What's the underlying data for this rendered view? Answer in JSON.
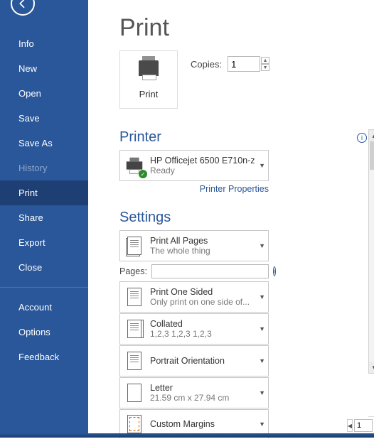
{
  "sidebar": {
    "items": [
      {
        "label": "Info"
      },
      {
        "label": "New"
      },
      {
        "label": "Open"
      },
      {
        "label": "Save"
      },
      {
        "label": "Save As"
      },
      {
        "label": "History"
      },
      {
        "label": "Print"
      },
      {
        "label": "Share"
      },
      {
        "label": "Export"
      },
      {
        "label": "Close"
      }
    ],
    "footer": [
      {
        "label": "Account"
      },
      {
        "label": "Options"
      },
      {
        "label": "Feedback"
      }
    ]
  },
  "page": {
    "title": "Print"
  },
  "print_button": {
    "label": "Print"
  },
  "copies": {
    "label": "Copies:",
    "value": "1"
  },
  "printer": {
    "heading": "Printer",
    "name": "HP Officejet 6500 E710n-z",
    "status": "Ready",
    "properties_link": "Printer Properties"
  },
  "settings": {
    "heading": "Settings",
    "pages_label": "Pages:",
    "pages_value": "",
    "items": {
      "range": {
        "line1": "Print All Pages",
        "line2": "The whole thing"
      },
      "sided": {
        "line1": "Print One Sided",
        "line2": "Only print on one side of..."
      },
      "collate": {
        "line1": "Collated",
        "line2": "1,2,3    1,2,3    1,2,3"
      },
      "orient": {
        "line1": "Portrait Orientation",
        "line2": ""
      },
      "size": {
        "line1": "Letter",
        "line2": "21.59 cm x 27.94 cm"
      },
      "margins": {
        "line1": "Custom Margins",
        "line2": ""
      }
    }
  },
  "preview": {
    "page_field": "1"
  }
}
